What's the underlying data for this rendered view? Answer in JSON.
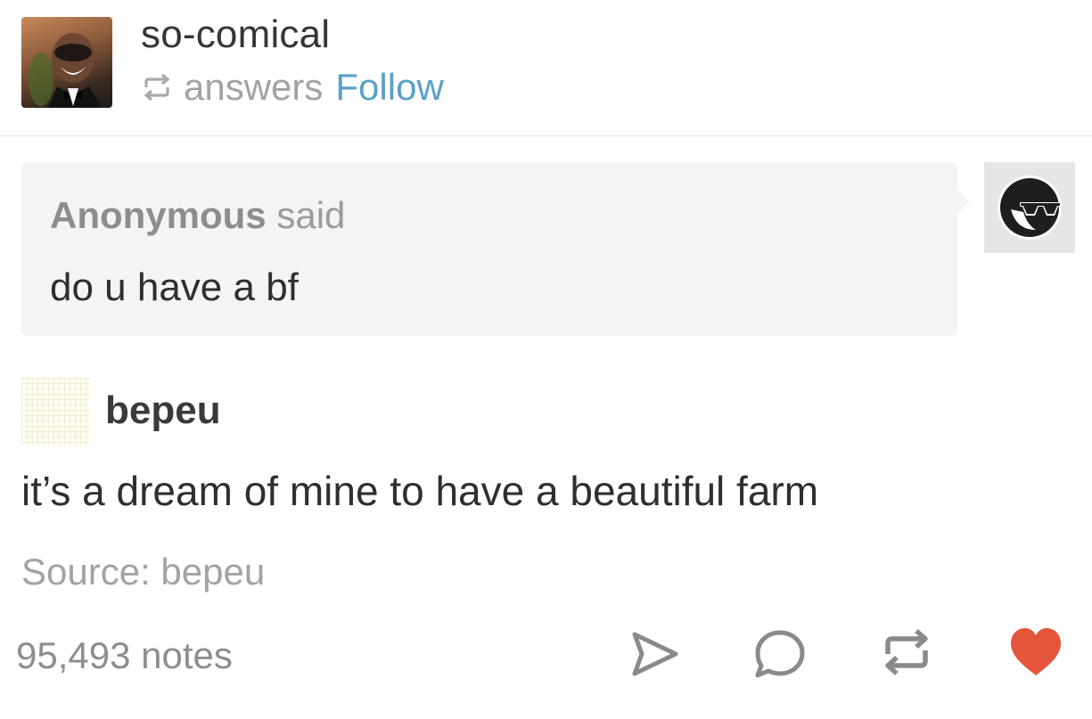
{
  "header": {
    "blog_name": "so-comical",
    "action_text": "answers",
    "follow_label": "Follow",
    "avatar_icon": "blog-avatar-photo"
  },
  "ask": {
    "asker": "Anonymous",
    "said": "said",
    "question": "do u have a bf",
    "avatar_icon": "anonymous-sunglasses-icon"
  },
  "answer": {
    "answerer": "bepeu",
    "text": "it’s a dream of mine to have a beautiful farm",
    "source_label": "Source: bepeu"
  },
  "footer": {
    "notes": "95,493 notes",
    "icons": [
      "share-icon",
      "reply-icon",
      "reblog-icon",
      "like-heart-icon"
    ]
  },
  "colors": {
    "follow": "#5aa0c9",
    "like": "#e4553b",
    "ask_background": "#f4f4f4",
    "muted_text": "#a3a3a3"
  }
}
